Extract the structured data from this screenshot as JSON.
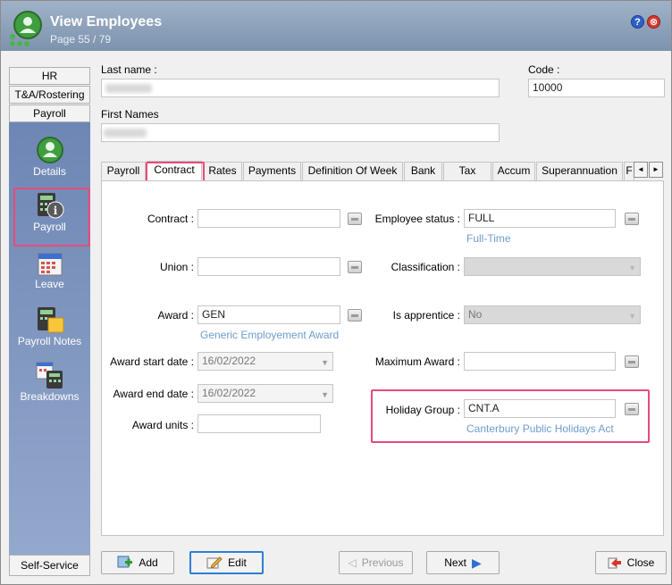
{
  "window": {
    "title": "View Employees",
    "subtitle": "Page 55 / 79",
    "help_symbol": "?",
    "close_symbol": "⊗"
  },
  "nav": {
    "tabs": [
      "HR",
      "T&A/Rostering",
      "Payroll"
    ],
    "items": [
      {
        "label": "Details",
        "icon": "details-icon"
      },
      {
        "label": "Payroll",
        "icon": "payroll-icon"
      },
      {
        "label": "Leave",
        "icon": "calendar-icon"
      },
      {
        "label": "Payroll Notes",
        "icon": "notes-icon"
      },
      {
        "label": "Breakdowns",
        "icon": "breakdown-icon"
      }
    ],
    "bottom": "Self-Service"
  },
  "header": {
    "last_name_label": "Last name :",
    "first_names_label": "First Names",
    "code_label": "Code :",
    "code_value": "10000"
  },
  "tabs": [
    "Payroll",
    "Contract",
    "Rates",
    "Payments",
    "Definition Of Week",
    "Bank",
    "Tax",
    "Accum",
    "Superannuation",
    "F"
  ],
  "tab_scroll": {
    "left": "◄",
    "right": "►"
  },
  "contract": {
    "contract_label": "Contract :",
    "contract_value": "",
    "union_label": "Union :",
    "union_value": "",
    "award_label": "Award :",
    "award_value": "GEN",
    "award_desc": "Generic Employement Award",
    "award_start_label": "Award start date :",
    "award_start_value": "16/02/2022",
    "award_end_label": "Award end date :",
    "award_end_value": "16/02/2022",
    "award_units_label": "Award units :",
    "award_units_value": "",
    "status_label": "Employee status :",
    "status_value": "FULL",
    "status_desc": "Full-Time",
    "classification_label": "Classification :",
    "classification_value": "",
    "apprentice_label": "Is apprentice :",
    "apprentice_value": "No",
    "max_award_label": "Maximum Award :",
    "max_award_value": "",
    "holiday_label": "Holiday Group :",
    "holiday_value": "CNT.A",
    "holiday_desc": "Canterbury Public Holidays Act"
  },
  "buttons": {
    "add": "Add",
    "edit": "Edit",
    "previous": "Previous",
    "next": "Next",
    "close": "Close"
  },
  "colors": {
    "titlebar": "#8ea3bd",
    "nav_panel": "#7f96c0",
    "highlight": "#e84a7a",
    "link": "#6e9ccc"
  }
}
